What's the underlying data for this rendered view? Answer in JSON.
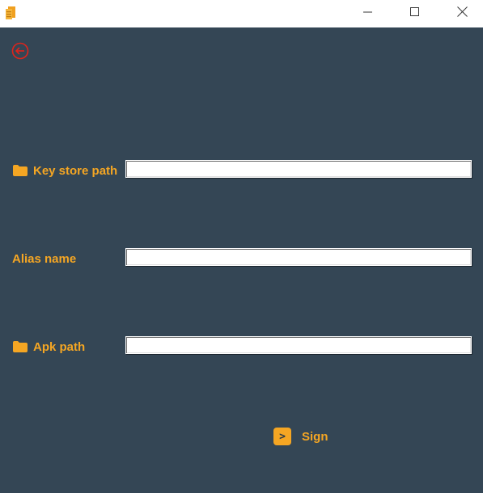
{
  "window": {
    "controls": {
      "minimize": "minimize-icon",
      "maximize": "maximize-icon",
      "close": "close-icon"
    }
  },
  "back_button": {
    "icon": "back-arrow-circle-icon",
    "color": "#e0241b"
  },
  "form": {
    "keystore": {
      "label": "Key store path",
      "icon": "folder-icon",
      "value": ""
    },
    "alias": {
      "label": "Alias name",
      "value": ""
    },
    "apk": {
      "label": "Apk path",
      "icon": "folder-icon",
      "value": ""
    }
  },
  "sign_button": {
    "label": "Sign",
    "icon": "terminal-prompt-icon",
    "icon_glyph": ">"
  },
  "colors": {
    "background": "#344655",
    "accent": "#f5a623",
    "back_icon": "#e0241b",
    "titlebar": "#ffffff"
  }
}
